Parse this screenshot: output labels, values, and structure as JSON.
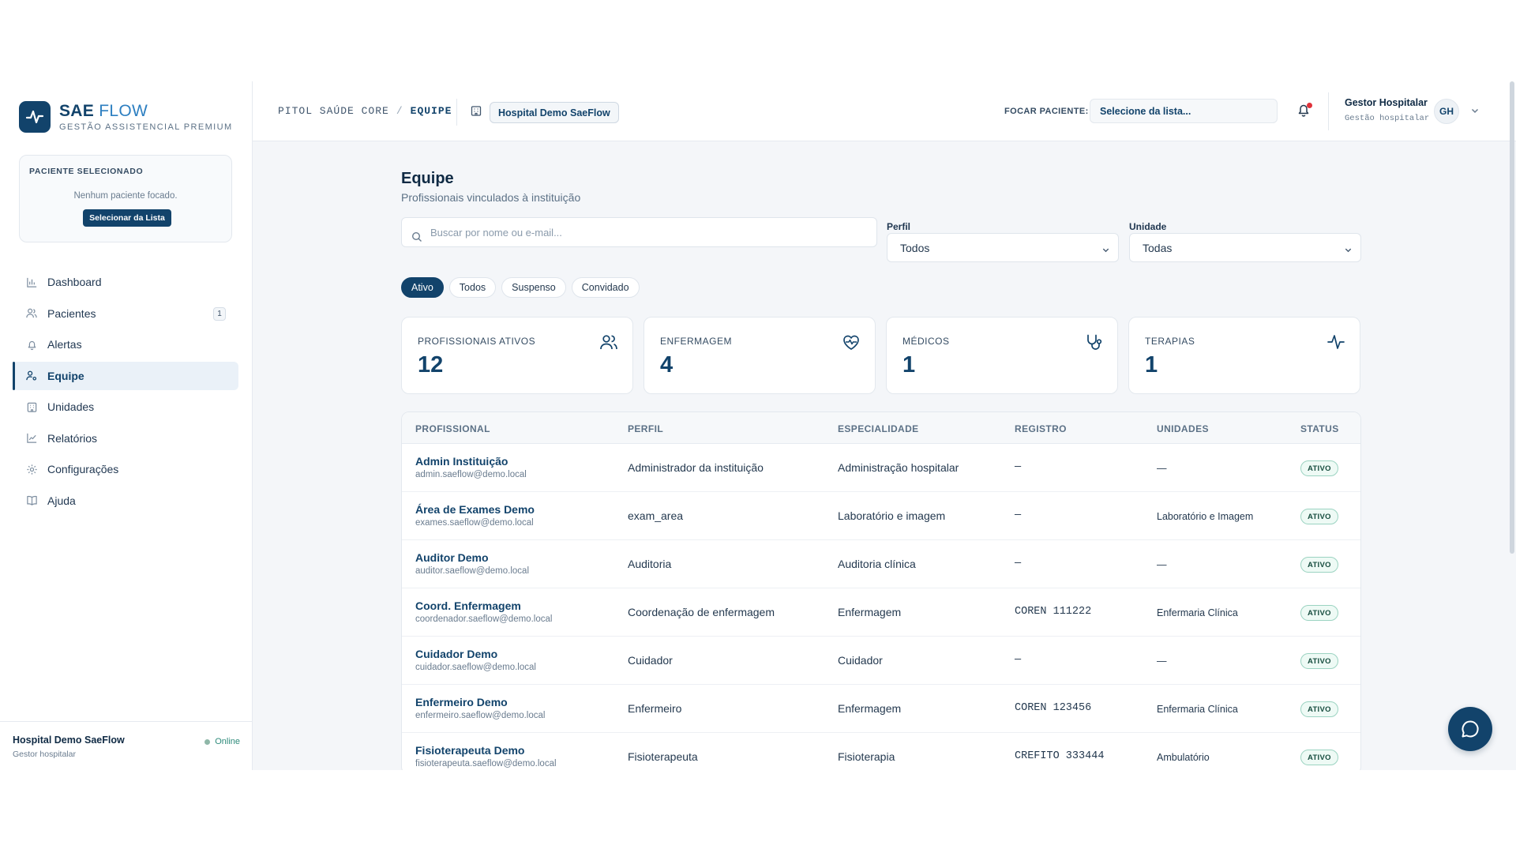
{
  "brand": {
    "name_bold": "SAE",
    "name_light": "FLOW",
    "tagline": "GESTÃO ASSISTENCIAL PREMIUM"
  },
  "patient_card": {
    "title": "PACIENTE SELECIONADO",
    "empty": "Nenhum paciente focado.",
    "button": "Selecionar da Lista"
  },
  "sidebar": {
    "items": [
      {
        "label": "Dashboard",
        "icon": "bar-chart-icon"
      },
      {
        "label": "Pacientes",
        "icon": "users-icon",
        "badge": "1"
      },
      {
        "label": "Alertas",
        "icon": "bell-icon"
      },
      {
        "label": "Equipe",
        "icon": "user-cog-icon",
        "active": true
      },
      {
        "label": "Unidades",
        "icon": "building-icon"
      },
      {
        "label": "Relatórios",
        "icon": "line-chart-icon"
      },
      {
        "label": "Configurações",
        "icon": "gear-icon"
      },
      {
        "label": "Ajuda",
        "icon": "book-icon"
      }
    ],
    "footer": {
      "name": "Hospital Demo SaeFlow",
      "role": "Gestor hospitalar",
      "status": "Online"
    }
  },
  "topbar": {
    "crumb_root": "PITOL SAÚDE CORE",
    "crumb_sep": "/",
    "crumb_current": "EQUIPE",
    "hospital": "Hospital Demo SaeFlow",
    "focus_label": "FOCAR PACIENTE:",
    "focus_value": "Selecione da lista...",
    "user_name": "Gestor Hospitalar",
    "user_role": "Gestão hospitalar",
    "user_initials": "GH"
  },
  "page": {
    "title": "Equipe",
    "subtitle": "Profissionais vinculados à instituição",
    "search_placeholder": "Buscar por nome ou e-mail...",
    "filter_perfil_label": "Perfil",
    "filter_perfil_value": "Todos",
    "filter_unidade_label": "Unidade",
    "filter_unidade_value": "Todas",
    "chips": [
      "Ativo",
      "Todos",
      "Suspenso",
      "Convidado"
    ],
    "active_chip": "Ativo"
  },
  "stats": [
    {
      "label": "PROFISSIONAIS ATIVOS",
      "value": "12",
      "icon": "users-icon"
    },
    {
      "label": "ENFERMAGEM",
      "value": "4",
      "icon": "heart-pulse-icon"
    },
    {
      "label": "MÉDICOS",
      "value": "1",
      "icon": "stethoscope-icon"
    },
    {
      "label": "TERAPIAS",
      "value": "1",
      "icon": "activity-icon"
    }
  ],
  "table": {
    "headers": [
      "PROFISSIONAL",
      "PERFIL",
      "ESPECIALIDADE",
      "REGISTRO",
      "UNIDADES",
      "STATUS"
    ],
    "rows": [
      {
        "name": "Admin Instituição",
        "email": "admin.saeflow@demo.local",
        "perfil": "Administrador da instituição",
        "especialidade": "Administração hospitalar",
        "registro": "—",
        "unidades": "—",
        "status": "ATIVO"
      },
      {
        "name": "Área de Exames Demo",
        "email": "exames.saeflow@demo.local",
        "perfil": "exam_area",
        "especialidade": "Laboratório e imagem",
        "registro": "—",
        "unidades": "Laboratório e Imagem",
        "status": "ATIVO"
      },
      {
        "name": "Auditor Demo",
        "email": "auditor.saeflow@demo.local",
        "perfil": "Auditoria",
        "especialidade": "Auditoria clínica",
        "registro": "—",
        "unidades": "—",
        "status": "ATIVO"
      },
      {
        "name": "Coord. Enfermagem",
        "email": "coordenador.saeflow@demo.local",
        "perfil": "Coordenação de enfermagem",
        "especialidade": "Enfermagem",
        "registro": "COREN 111222",
        "unidades": "Enfermaria Clínica",
        "status": "ATIVO"
      },
      {
        "name": "Cuidador Demo",
        "email": "cuidador.saeflow@demo.local",
        "perfil": "Cuidador",
        "especialidade": "Cuidador",
        "registro": "—",
        "unidades": "—",
        "status": "ATIVO"
      },
      {
        "name": "Enfermeiro Demo",
        "email": "enfermeiro.saeflow@demo.local",
        "perfil": "Enfermeiro",
        "especialidade": "Enfermagem",
        "registro": "COREN 123456",
        "unidades": "Enfermaria Clínica",
        "status": "ATIVO"
      },
      {
        "name": "Fisioterapeuta Demo",
        "email": "fisioterapeuta.saeflow@demo.local",
        "perfil": "Fisioterapeuta",
        "especialidade": "Fisioterapia",
        "registro": "CREFITO 333444",
        "unidades": "Ambulatório",
        "status": "ATIVO"
      }
    ]
  },
  "colors": {
    "primary": "#12436b",
    "accent": "#2d7fc1",
    "badge_bg": "#eefaf5",
    "alert": "#e0323a"
  }
}
